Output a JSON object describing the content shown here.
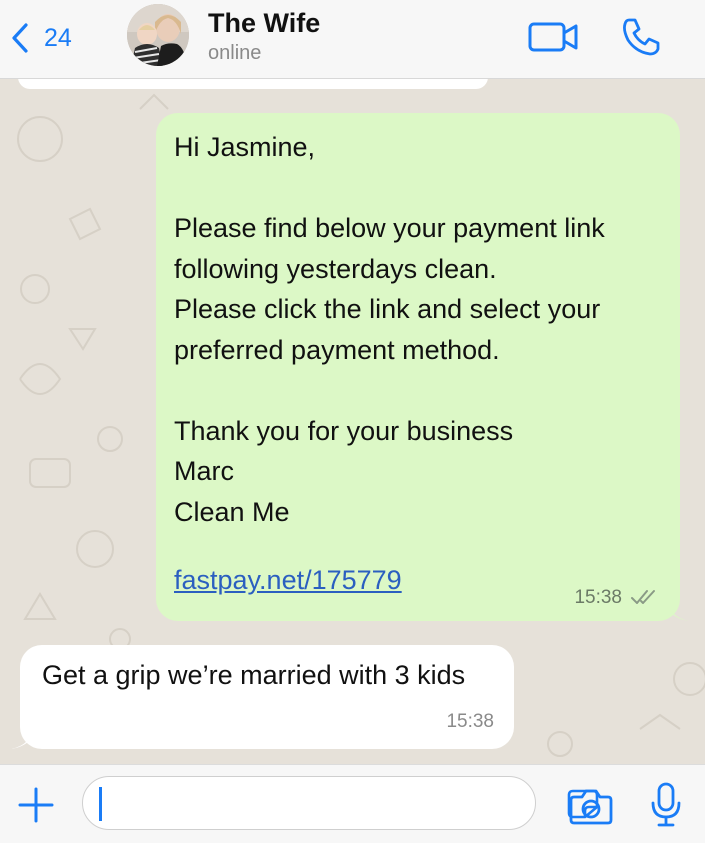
{
  "header": {
    "back_count": "24",
    "contact_name": "The Wife",
    "status": "online"
  },
  "messages": [
    {
      "direction": "outgoing",
      "text": "Hi Jasmine,\n\nPlease find below your payment link following yesterdays clean.\nPlease click the link and select your preferred payment method.\n\nThank you for your business\nMarc\nClean Me",
      "link": "fastpay.net/175779",
      "time": "15:38",
      "read_status": "read"
    },
    {
      "direction": "incoming",
      "text": "Get a grip we’re married with 3 kids",
      "time": "15:38"
    }
  ],
  "input": {
    "value": "",
    "placeholder": ""
  },
  "colors": {
    "accent": "#1a7cf6",
    "outgoing_bubble": "#dcf8c6",
    "incoming_bubble": "#ffffff",
    "chat_background": "#e6e1d9",
    "link": "#2b5fc0"
  },
  "icons": {
    "back": "chevron-left-icon",
    "video": "video-camera-icon",
    "call": "phone-icon",
    "attach": "plus-icon",
    "sticker": "sticker-icon",
    "camera": "camera-icon",
    "mic": "microphone-icon",
    "read": "double-check-icon"
  }
}
